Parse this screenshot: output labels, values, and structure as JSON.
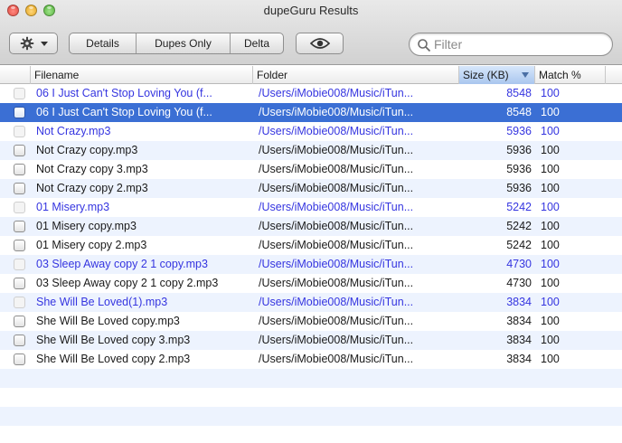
{
  "window": {
    "title": "dupeGuru Results"
  },
  "toolbar": {
    "action_icon": "gear-icon",
    "segments": [
      "Details",
      "Dupes Only",
      "Delta"
    ],
    "preview_icon": "eye-icon",
    "search": {
      "value": "",
      "placeholder": "Filter"
    }
  },
  "columns": {
    "filename": "Filename",
    "folder": "Folder",
    "size": "Size (KB)",
    "match": "Match %"
  },
  "colors": {
    "reference_text": "#3535e0",
    "selection": "#3b6fd4",
    "alt_row": "#edf3fe"
  },
  "rows": [
    {
      "filename": "06 I Just Can't Stop Loving You (f...",
      "folder": "/Users/iMobie008/Music/iTun...",
      "size": "8548",
      "match": "100",
      "reference": true,
      "selected": false
    },
    {
      "filename": "06 I Just Can't Stop Loving You (f...",
      "folder": "/Users/iMobie008/Music/iTun...",
      "size": "8548",
      "match": "100",
      "reference": false,
      "selected": true
    },
    {
      "filename": "Not Crazy.mp3",
      "folder": "/Users/iMobie008/Music/iTun...",
      "size": "5936",
      "match": "100",
      "reference": true,
      "selected": false
    },
    {
      "filename": "Not Crazy copy.mp3",
      "folder": "/Users/iMobie008/Music/iTun...",
      "size": "5936",
      "match": "100",
      "reference": false,
      "selected": false
    },
    {
      "filename": "Not Crazy copy 3.mp3",
      "folder": "/Users/iMobie008/Music/iTun...",
      "size": "5936",
      "match": "100",
      "reference": false,
      "selected": false
    },
    {
      "filename": "Not Crazy copy 2.mp3",
      "folder": "/Users/iMobie008/Music/iTun...",
      "size": "5936",
      "match": "100",
      "reference": false,
      "selected": false
    },
    {
      "filename": "01 Misery.mp3",
      "folder": "/Users/iMobie008/Music/iTun...",
      "size": "5242",
      "match": "100",
      "reference": true,
      "selected": false
    },
    {
      "filename": "01 Misery copy.mp3",
      "folder": "/Users/iMobie008/Music/iTun...",
      "size": "5242",
      "match": "100",
      "reference": false,
      "selected": false
    },
    {
      "filename": "01 Misery copy 2.mp3",
      "folder": "/Users/iMobie008/Music/iTun...",
      "size": "5242",
      "match": "100",
      "reference": false,
      "selected": false
    },
    {
      "filename": "03 Sleep Away copy 2 1 copy.mp3",
      "folder": "/Users/iMobie008/Music/iTun...",
      "size": "4730",
      "match": "100",
      "reference": true,
      "selected": false
    },
    {
      "filename": "03 Sleep Away copy 2 1 copy 2.mp3",
      "folder": "/Users/iMobie008/Music/iTun...",
      "size": "4730",
      "match": "100",
      "reference": false,
      "selected": false
    },
    {
      "filename": "She Will Be Loved(1).mp3",
      "folder": "/Users/iMobie008/Music/iTun...",
      "size": "3834",
      "match": "100",
      "reference": true,
      "selected": false
    },
    {
      "filename": "She Will Be Loved copy.mp3",
      "folder": "/Users/iMobie008/Music/iTun...",
      "size": "3834",
      "match": "100",
      "reference": false,
      "selected": false
    },
    {
      "filename": "She Will Be Loved copy 3.mp3",
      "folder": "/Users/iMobie008/Music/iTun...",
      "size": "3834",
      "match": "100",
      "reference": false,
      "selected": false
    },
    {
      "filename": "She Will Be Loved copy 2.mp3",
      "folder": "/Users/iMobie008/Music/iTun...",
      "size": "3834",
      "match": "100",
      "reference": false,
      "selected": false
    }
  ]
}
